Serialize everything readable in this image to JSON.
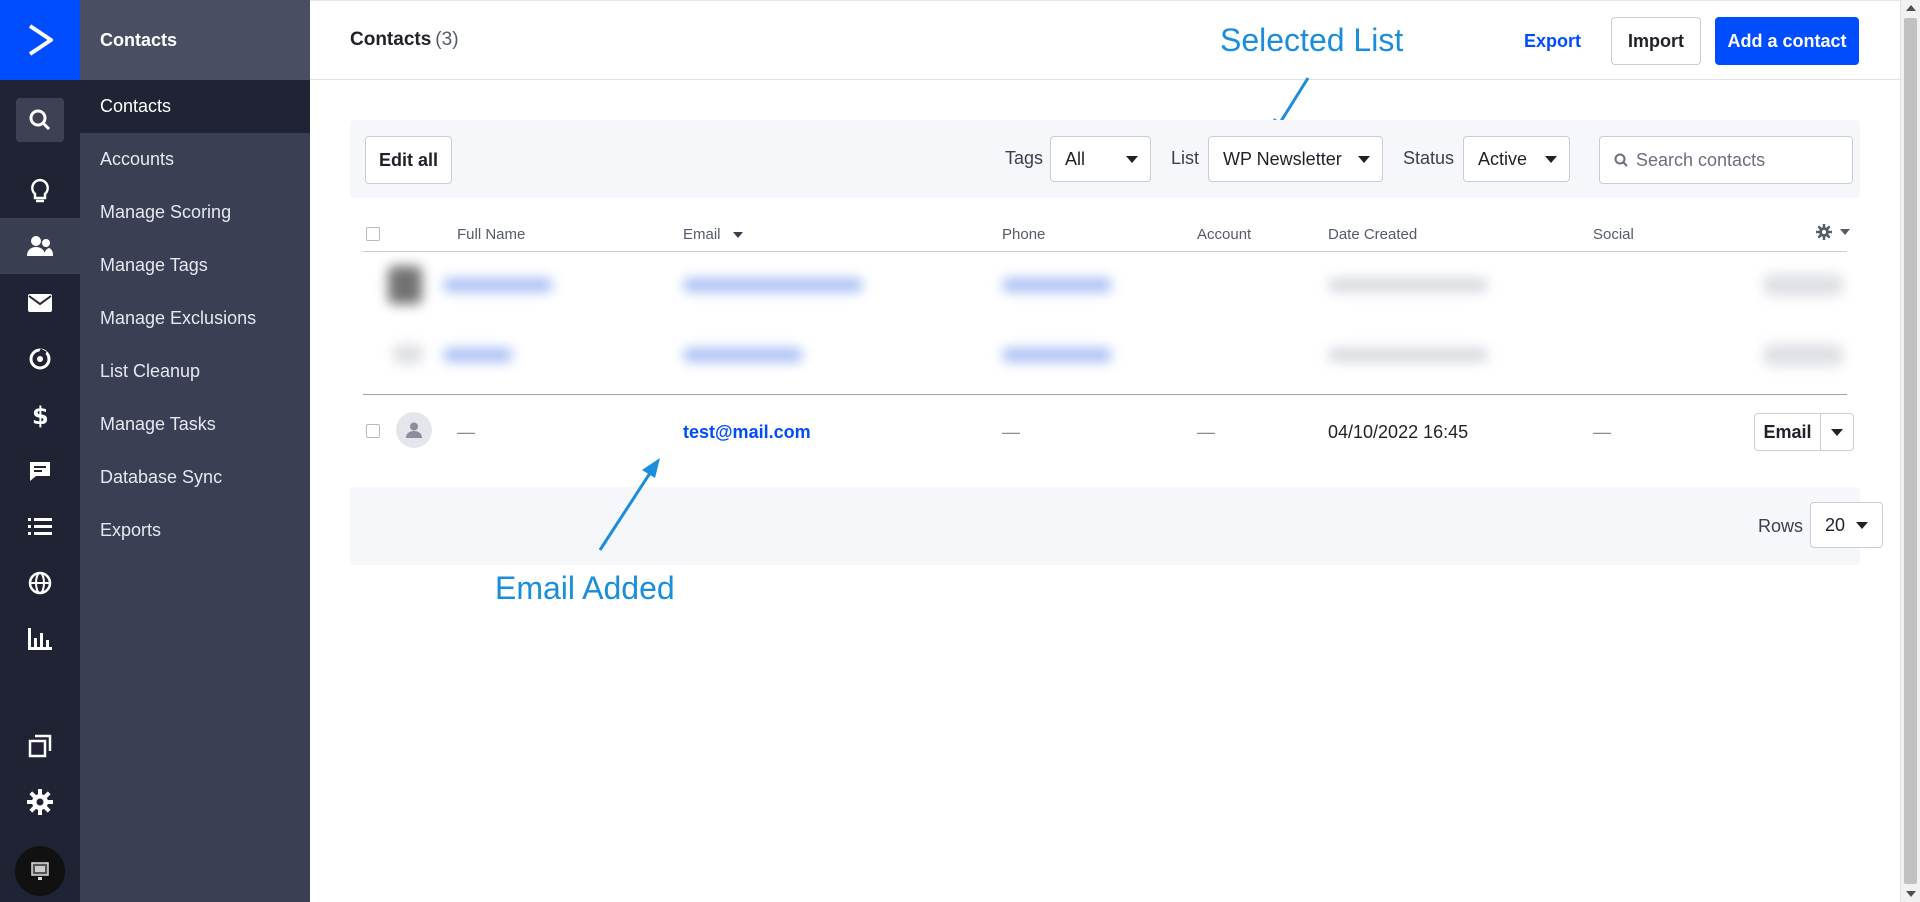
{
  "colors": {
    "accent": "#004cff",
    "rail_bg": "#1f2333",
    "subnav_bg": "#3b3f53",
    "annotation": "#1a8ddd"
  },
  "rail": {
    "logo_icon": "chevron-right-icon",
    "items": [
      "search-icon",
      "lightbulb-icon",
      "contacts-icon",
      "envelope-icon",
      "automation-icon",
      "dollar-icon",
      "chat-icon",
      "list-icon",
      "globe-icon",
      "bar-chart-icon",
      "pages-icon",
      "gear-icon"
    ]
  },
  "subnav": {
    "title": "Contacts",
    "items": [
      {
        "label": "Contacts",
        "active": true
      },
      {
        "label": "Accounts"
      },
      {
        "label": "Manage Scoring"
      },
      {
        "label": "Manage Tags"
      },
      {
        "label": "Manage Exclusions"
      },
      {
        "label": "List Cleanup"
      },
      {
        "label": "Manage Tasks"
      },
      {
        "label": "Database Sync"
      },
      {
        "label": "Exports"
      }
    ]
  },
  "header": {
    "title": "Contacts",
    "count": "(3)",
    "export_label": "Export",
    "import_label": "Import",
    "add_label": "Add a contact"
  },
  "filters": {
    "edit_all_label": "Edit all",
    "tags_label": "Tags",
    "tags_value": "All",
    "list_label": "List",
    "list_value": "WP Newsletter",
    "status_label": "Status",
    "status_value": "Active",
    "search_placeholder": "Search contacts"
  },
  "table": {
    "columns": [
      "Full Name",
      "Email",
      "Phone",
      "Account",
      "Date Created",
      "Social"
    ],
    "row": {
      "full_name": "—",
      "email": "test@mail.com",
      "phone": "—",
      "account": "—",
      "date_created": "04/10/2022 16:45",
      "social": "—",
      "action_label": "Email"
    }
  },
  "pagination": {
    "rows_label": "Rows",
    "rows_value": "20"
  },
  "annotations": {
    "selected_list": "Selected List",
    "email_added": "Email Added"
  }
}
